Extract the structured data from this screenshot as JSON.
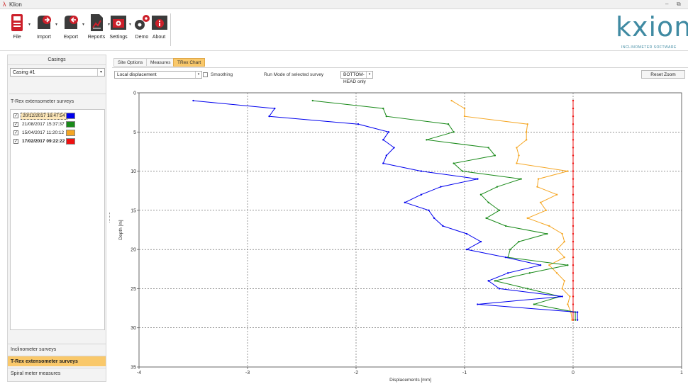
{
  "window": {
    "title": "Klion",
    "app_mark": "λ",
    "controls": [
      "–",
      "⧉"
    ]
  },
  "ribbon": {
    "buttons": [
      {
        "label": "File",
        "icon": "file-icon"
      },
      {
        "label": "Import",
        "icon": "import-icon"
      },
      {
        "label": "Export",
        "icon": "export-icon"
      },
      {
        "label": "Reports",
        "icon": "reports-icon"
      },
      {
        "label": "Settings",
        "icon": "settings-icon"
      },
      {
        "label": "Demo",
        "icon": "demo-icon"
      },
      {
        "label": "About",
        "icon": "about-icon"
      }
    ],
    "logo": {
      "text": "kxion",
      "subtitle": "INCLINOMETER SOFTWARE",
      "color": "#3f8aa2"
    }
  },
  "left_panel": {
    "header": "Casings",
    "casing_selected": "Casing #1",
    "surveys_header": "T-Rex extensometer surveys",
    "surveys": [
      {
        "date": "20/12/2017 16:47:54",
        "checked": true,
        "color": "#0000ee",
        "selected": true,
        "bold": false
      },
      {
        "date": "21/08/2017 15:37:37",
        "checked": true,
        "color": "#1a8a1a",
        "selected": false,
        "bold": false
      },
      {
        "date": "15/04/2017 11:20:12",
        "checked": true,
        "color": "#f5a623",
        "selected": false,
        "bold": false
      },
      {
        "date": "17/02/2017 09:22:22",
        "checked": true,
        "color": "#ee1111",
        "selected": false,
        "bold": true
      }
    ],
    "nav": [
      {
        "label": "Inclinometer surveys",
        "active": false
      },
      {
        "label": "T-Rex extensometer surveys",
        "active": true
      },
      {
        "label": "Spiral meter measures",
        "active": false
      }
    ]
  },
  "tabs": [
    {
      "label": "Site Options",
      "active": false
    },
    {
      "label": "Measures",
      "active": false
    },
    {
      "label": "TRex Chart",
      "active": true
    }
  ],
  "controls": {
    "display_mode": "Local displacement",
    "smoothing_label": "Smoothing",
    "smoothing_checked": false,
    "run_mode_label": "Run Mode of selected survey",
    "run_mode_value": "BOTTOM-HEAD only",
    "reset_zoom": "Reset Zoom"
  },
  "chart_data": {
    "type": "line",
    "xlabel": "Displacements [mm]",
    "ylabel": "Depth [m]",
    "xlim": [
      -4,
      1
    ],
    "ylim": [
      35,
      0
    ],
    "xticks": [
      "-4",
      "-3",
      "-2",
      "-1",
      "0",
      "1"
    ],
    "yticks": [
      "0",
      "5",
      "10",
      "15",
      "20",
      "25",
      "30",
      "35"
    ],
    "grid": true,
    "series": [
      {
        "color": "#0000ee",
        "points": [
          [
            -3.5,
            1
          ],
          [
            -2.75,
            2
          ],
          [
            -2.8,
            3
          ],
          [
            -1.98,
            4
          ],
          [
            -1.7,
            5
          ],
          [
            -1.75,
            6
          ],
          [
            -1.65,
            7
          ],
          [
            -1.72,
            8
          ],
          [
            -1.75,
            9
          ],
          [
            -1.4,
            10
          ],
          [
            -0.88,
            11
          ],
          [
            -1.22,
            12
          ],
          [
            -1.4,
            13
          ],
          [
            -1.55,
            14
          ],
          [
            -1.33,
            15
          ],
          [
            -1.28,
            16
          ],
          [
            -1.2,
            17
          ],
          [
            -0.98,
            18
          ],
          [
            -0.85,
            19
          ],
          [
            -0.98,
            20
          ],
          [
            -0.62,
            21
          ],
          [
            -0.3,
            22
          ],
          [
            -0.6,
            23
          ],
          [
            -0.78,
            24
          ],
          [
            -0.68,
            25
          ],
          [
            -0.1,
            26
          ],
          [
            -0.88,
            27
          ],
          [
            0.04,
            28
          ],
          [
            0.04,
            29
          ]
        ]
      },
      {
        "color": "#1a8a1a",
        "points": [
          [
            -2.4,
            1
          ],
          [
            -1.75,
            2
          ],
          [
            -1.72,
            3
          ],
          [
            -1.15,
            4
          ],
          [
            -1.1,
            5
          ],
          [
            -1.35,
            6
          ],
          [
            -0.78,
            7
          ],
          [
            -0.72,
            8
          ],
          [
            -1.1,
            9
          ],
          [
            -1.02,
            10
          ],
          [
            -0.48,
            11
          ],
          [
            -0.7,
            12
          ],
          [
            -0.85,
            13
          ],
          [
            -0.78,
            14
          ],
          [
            -0.68,
            15
          ],
          [
            -0.8,
            16
          ],
          [
            -0.62,
            17
          ],
          [
            -0.24,
            18
          ],
          [
            -0.5,
            19
          ],
          [
            -0.58,
            20
          ],
          [
            -0.6,
            21
          ],
          [
            -0.05,
            22
          ],
          [
            -0.4,
            23
          ],
          [
            -0.72,
            24
          ],
          [
            -0.42,
            25
          ],
          [
            -0.12,
            26
          ],
          [
            -0.36,
            27
          ],
          [
            0.02,
            28
          ],
          [
            0.02,
            29
          ]
        ]
      },
      {
        "color": "#f5a623",
        "points": [
          [
            -1.12,
            1
          ],
          [
            -1.0,
            2
          ],
          [
            -1.0,
            3
          ],
          [
            -0.42,
            4
          ],
          [
            -0.43,
            5
          ],
          [
            -0.43,
            6
          ],
          [
            -0.52,
            7
          ],
          [
            -0.5,
            8
          ],
          [
            -0.52,
            9
          ],
          [
            -0.05,
            10
          ],
          [
            -0.32,
            11
          ],
          [
            -0.33,
            12
          ],
          [
            -0.15,
            13
          ],
          [
            -0.3,
            14
          ],
          [
            -0.25,
            15
          ],
          [
            -0.42,
            16
          ],
          [
            -0.22,
            17
          ],
          [
            -0.1,
            18
          ],
          [
            -0.08,
            19
          ],
          [
            -0.15,
            20
          ],
          [
            -0.08,
            21
          ],
          [
            -0.22,
            22
          ],
          [
            -0.15,
            23
          ],
          [
            -0.08,
            24
          ],
          [
            -0.1,
            25
          ],
          [
            -0.03,
            26
          ],
          [
            -0.05,
            27
          ],
          [
            -0.02,
            28
          ],
          [
            -0.01,
            29
          ]
        ]
      },
      {
        "color": "#ee1111",
        "points": [
          [
            0,
            1
          ],
          [
            0,
            2
          ],
          [
            0,
            3
          ],
          [
            0,
            4
          ],
          [
            0,
            5
          ],
          [
            0,
            6
          ],
          [
            0,
            7
          ],
          [
            0,
            8
          ],
          [
            0,
            9
          ],
          [
            0,
            10
          ],
          [
            0,
            11
          ],
          [
            0,
            12
          ],
          [
            0,
            13
          ],
          [
            0,
            14
          ],
          [
            0,
            15
          ],
          [
            0,
            16
          ],
          [
            0,
            17
          ],
          [
            0,
            18
          ],
          [
            0,
            19
          ],
          [
            0,
            20
          ],
          [
            0,
            21
          ],
          [
            0,
            22
          ],
          [
            0,
            23
          ],
          [
            0,
            24
          ],
          [
            0,
            25
          ],
          [
            0,
            26
          ],
          [
            0,
            27
          ],
          [
            0,
            28
          ],
          [
            0,
            29
          ]
        ]
      }
    ]
  }
}
